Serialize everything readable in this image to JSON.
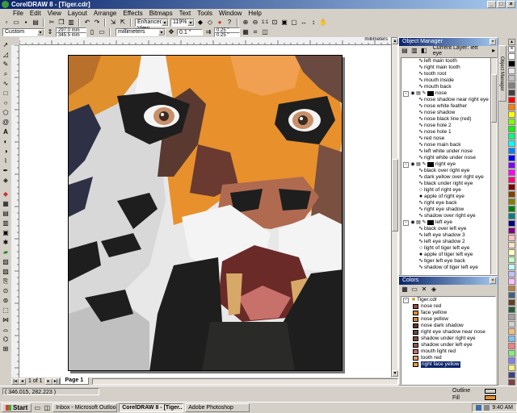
{
  "window": {
    "title": "CorelDRAW 8 - [Tiger.cdr]",
    "controls": [
      "_",
      "□",
      "×"
    ]
  },
  "menu": [
    "File",
    "Edit",
    "View",
    "Layout",
    "Arrange",
    "Effects",
    "Bitmaps",
    "Text",
    "Tools",
    "Window",
    "Help"
  ],
  "toolbar": {
    "view_quality": "Enhanced View",
    "zoom": "119%"
  },
  "property_bar": {
    "paper": "Custom",
    "width": "297.0 mm",
    "height": "345.5 mm",
    "units": "millimeters",
    "nudge": "0.1 \"",
    "dup_x": "0.25 \"",
    "dup_y": "0.25 \""
  },
  "ruler": {
    "units": "millimeters"
  },
  "object_manager": {
    "title": "Object Manager",
    "current_layer": "Current Layer: left eye",
    "items": [
      {
        "label": "left main tooth",
        "kind": "curve"
      },
      {
        "label": "right main tooth",
        "kind": "curve"
      },
      {
        "label": "tooth root",
        "kind": "curve"
      },
      {
        "label": "mouth inside",
        "kind": "curve"
      },
      {
        "label": "mouth back",
        "kind": "curve"
      },
      {
        "label": "nose",
        "kind": "group"
      },
      {
        "label": "nose shadow near right eye",
        "kind": "curve"
      },
      {
        "label": "nose white feather",
        "kind": "curve"
      },
      {
        "label": "nose shadow",
        "kind": "curve"
      },
      {
        "label": "nose black line (red)",
        "kind": "curve"
      },
      {
        "label": "nose hole 2",
        "kind": "curve"
      },
      {
        "label": "nose hole 1",
        "kind": "curve"
      },
      {
        "label": "red nose",
        "kind": "curve"
      },
      {
        "label": "nose main back",
        "kind": "curve"
      },
      {
        "label": "left white under nose",
        "kind": "curve"
      },
      {
        "label": "right white under nose",
        "kind": "curve"
      },
      {
        "label": "right eye",
        "kind": "group"
      },
      {
        "label": "black over right eye",
        "kind": "curve"
      },
      {
        "label": "dark yellow over right eye",
        "kind": "curve"
      },
      {
        "label": "black under right eye",
        "kind": "curve"
      },
      {
        "label": "light of right eye",
        "kind": "ellipse-open"
      },
      {
        "label": "apple of right eye",
        "kind": "ellipse"
      },
      {
        "label": "right eye back",
        "kind": "curve"
      },
      {
        "label": "right eye shadow",
        "kind": "curve"
      },
      {
        "label": "shadow over right eye",
        "kind": "curve"
      },
      {
        "label": "left eye",
        "kind": "group"
      },
      {
        "label": "black over left eye",
        "kind": "curve"
      },
      {
        "label": "left eye shadow 3",
        "kind": "curve"
      },
      {
        "label": "left eye shadow 2",
        "kind": "curve"
      },
      {
        "label": "light of tiger left eye",
        "kind": "ellipse-open"
      },
      {
        "label": "apple of tiger left eye",
        "kind": "ellipse"
      },
      {
        "label": "tiger left eye back",
        "kind": "curve"
      },
      {
        "label": "shadow of tiger left eye",
        "kind": "curve"
      }
    ]
  },
  "colors_docker": {
    "title": "Colors",
    "root": "Tiger.cdr",
    "items": [
      {
        "label": "nose red",
        "color": "#9a4a3c"
      },
      {
        "label": "face yellow",
        "color": "#e0902c"
      },
      {
        "label": "nose yellow",
        "color": "#d48a3a"
      },
      {
        "label": "nose dark shadow",
        "color": "#5a3a30"
      },
      {
        "label": "right eye shadow near nose",
        "color": "#6a4a40"
      },
      {
        "label": "shadow under right eye",
        "color": "#7a5040"
      },
      {
        "label": "shadow under left eye",
        "color": "#8a6050"
      },
      {
        "label": "mouth light red",
        "color": "#c8706a"
      },
      {
        "label": "tooth red",
        "color": "#d8a070"
      },
      {
        "label": "right face yellow",
        "color": "#e89838"
      }
    ]
  },
  "page_nav": {
    "info": "1 of 1",
    "tab": "Page 1"
  },
  "status": {
    "coords": "( 346.015, 282.223 )",
    "outline": "Outline",
    "fill": "Fill"
  },
  "taskbar": {
    "start": "Start",
    "tasks": [
      "Inbox - Microsoft Outlook",
      "CorelDRAW 8 - [Tiger...",
      "Adobe Photoshop"
    ],
    "clock": "9:40 AM"
  },
  "palette": [
    "#ffffff",
    "#000000",
    "#e8e8e8",
    "#c0c0c0",
    "#808080",
    "#404040",
    "#ff0000",
    "#ff8000",
    "#ffff00",
    "#80ff00",
    "#00ff00",
    "#00ff80",
    "#00ffff",
    "#0080ff",
    "#0000ff",
    "#8000ff",
    "#ff00ff",
    "#ff0080",
    "#800000",
    "#804000",
    "#808000",
    "#008000",
    "#008080",
    "#000080",
    "#800080",
    "#ffc0c0",
    "#ffe0c0",
    "#ffffc0",
    "#c0ffc0",
    "#c0ffff",
    "#c0c0ff",
    "#ffc0ff",
    "#c08040",
    "#406080",
    "#604020",
    "#206040",
    "#a0a0a0",
    "#d0d0d0",
    "#f0c080",
    "#80c0f0",
    "#f08080",
    "#80f080",
    "#8080f0",
    "#f0f080",
    "#404080",
    "#804040"
  ]
}
